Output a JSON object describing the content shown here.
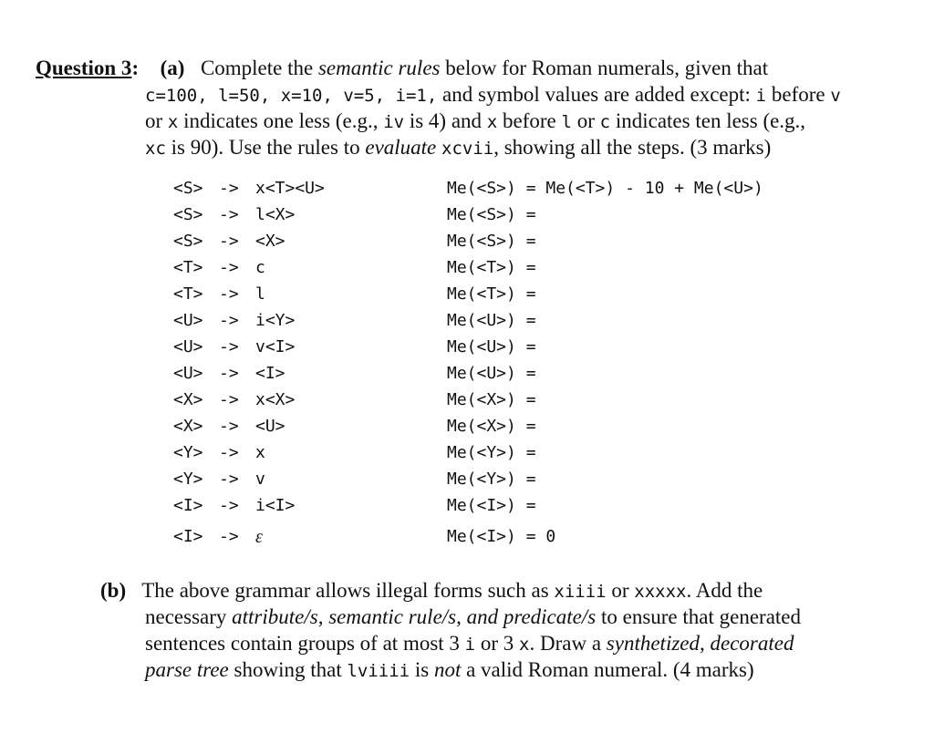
{
  "question": {
    "label": "Question 3",
    "colon": ":",
    "part_a": {
      "label": "(a)",
      "line1": {
        "t1": "Complete the ",
        "em1": "semantic rules",
        "t2": " below for Roman numerals, given that"
      },
      "line2": {
        "c1": "c=100, l=50, x=10, v=5, i=1,",
        "t1": " and symbol values are added except: ",
        "c2": "i",
        "t2": " before ",
        "c3": "v"
      },
      "line3": {
        "t1": "or ",
        "c1": "x",
        "t2": " indicates one less (e.g., ",
        "c2": "iv",
        "t3": " is 4) and ",
        "c3": "x",
        "t4": " before ",
        "c4": "l",
        "t5": " or ",
        "c5": "c",
        "t6": " indicates ten less (e.g.,"
      },
      "line4": {
        "c1": "xc",
        "t1": " is 90). Use the rules to ",
        "em1": "evaluate",
        "t2": " ",
        "c2": "xcvii",
        "t3": ", showing all the steps.  (3 marks)"
      }
    },
    "grammar": [
      {
        "lhs": "<S>",
        "arrow": "->",
        "rhs": "x<T><U>",
        "rule": "Me(<S>) = Me(<T>) - 10 + Me(<U>)"
      },
      {
        "lhs": "<S>",
        "arrow": "->",
        "rhs": "l<X>",
        "rule": "Me(<S>) ="
      },
      {
        "lhs": "<S>",
        "arrow": "->",
        "rhs": "<X>",
        "rule": "Me(<S>) ="
      },
      {
        "lhs": "<T>",
        "arrow": "->",
        "rhs": "c",
        "rule": "Me(<T>) ="
      },
      {
        "lhs": "<T>",
        "arrow": "->",
        "rhs": "l",
        "rule": "Me(<T>) ="
      },
      {
        "lhs": "<U>",
        "arrow": "->",
        "rhs": "i<Y>",
        "rule": "Me(<U>) ="
      },
      {
        "lhs": "<U>",
        "arrow": "->",
        "rhs": "v<I>",
        "rule": "Me(<U>) ="
      },
      {
        "lhs": "<U>",
        "arrow": "->",
        "rhs": "<I>",
        "rule": "Me(<U>) ="
      },
      {
        "lhs": "<X>",
        "arrow": "->",
        "rhs": "x<X>",
        "rule": "Me(<X>) ="
      },
      {
        "lhs": "<X>",
        "arrow": "->",
        "rhs": "<U>",
        "rule": "Me(<X>) ="
      },
      {
        "lhs": "<Y>",
        "arrow": "->",
        "rhs": "x",
        "rule": "Me(<Y>) ="
      },
      {
        "lhs": "<Y>",
        "arrow": "->",
        "rhs": "v",
        "rule": "Me(<Y>) ="
      },
      {
        "lhs": "<I>",
        "arrow": "->",
        "rhs": "i<I>",
        "rule": "Me(<I>) ="
      },
      {
        "lhs": "<I>",
        "arrow": "->",
        "rhs": "ε",
        "rule": "Me(<I>) = 0"
      }
    ],
    "part_b": {
      "label": "(b)",
      "line1": {
        "t1": "The above grammar allows illegal forms such as ",
        "c1": "xiiii",
        "t2": " or ",
        "c2": "xxxxx",
        "t3": ". Add the"
      },
      "line2": {
        "t1": "necessary ",
        "em1": "attribute/s, semantic rule/s, and predicate/s",
        "t2": " to ensure that generated"
      },
      "line3": {
        "t1": "sentences contain groups of at most 3 ",
        "c1": "i",
        "t2": " or 3 ",
        "c2": "x",
        "t3": ". Draw a ",
        "em1": "synthetized, decorated"
      },
      "line4": {
        "em1": "parse tree",
        "t1": " showing that ",
        "c1": "lviiii",
        "t2": " is ",
        "em2": "not",
        "t3": " a valid Roman numeral.  (4 marks)"
      }
    }
  }
}
